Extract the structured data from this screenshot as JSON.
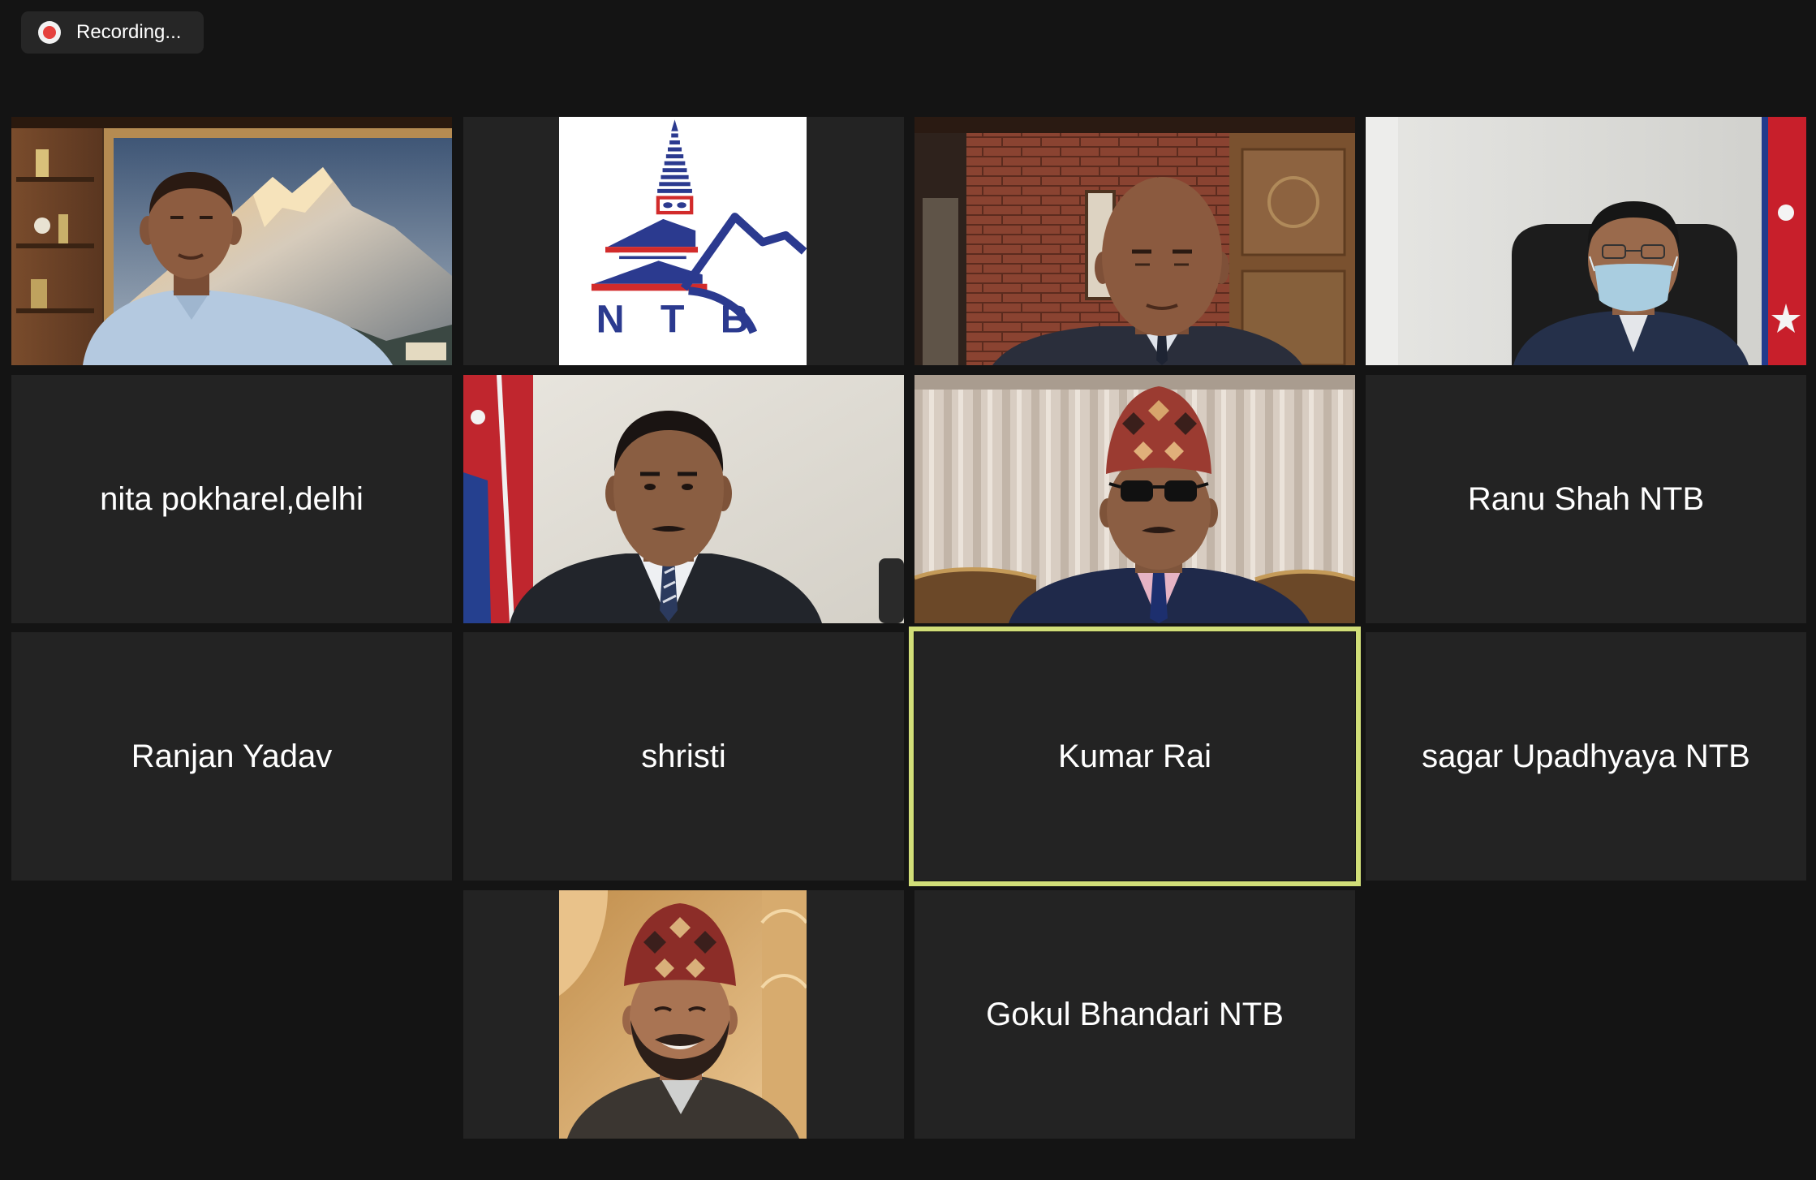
{
  "meeting": {
    "recording": {
      "label": "Recording...",
      "indicator_color": "#e5413d"
    }
  },
  "theme": {
    "background": "#141414",
    "tile": "#232323",
    "active_speaker_border": "#d1de78",
    "name_text": "#ffffff"
  },
  "gallery": {
    "logo_tile": {
      "logo_text": "NTB"
    },
    "name_tiles": [
      {
        "name": "nita pokharel,delhi",
        "active_speaker": false
      },
      {
        "name": "Ranu Shah NTB",
        "active_speaker": false
      },
      {
        "name": "Ranjan Yadav",
        "active_speaker": false
      },
      {
        "name": "shristi",
        "active_speaker": false
      },
      {
        "name": "Kumar Rai",
        "active_speaker": true
      },
      {
        "name": "sagar Upadhyaya NTB",
        "active_speaker": false
      },
      {
        "name": "Gokul Bhandari NTB",
        "active_speaker": false
      }
    ]
  }
}
